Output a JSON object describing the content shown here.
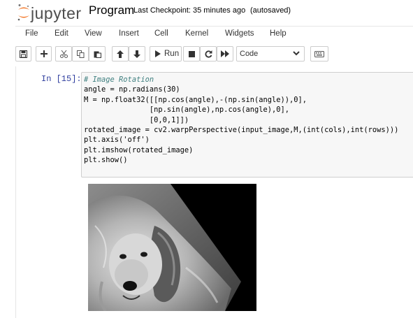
{
  "header": {
    "logo_text": "jupyter",
    "notebook_title": "Program",
    "checkpoint": "Last Checkpoint: 35 minutes ago",
    "autosave": "(autosaved)"
  },
  "menu": [
    "File",
    "Edit",
    "View",
    "Insert",
    "Cell",
    "Kernel",
    "Widgets",
    "Help"
  ],
  "toolbar": {
    "run_label": "Run",
    "cell_type": "Code",
    "icons": [
      "save-icon",
      "plus-icon",
      "cut-icon",
      "copy-icon",
      "paste-icon",
      "arrow-up-icon",
      "arrow-down-icon",
      "run-icon",
      "stop-icon",
      "restart-icon",
      "fast-forward-icon",
      "keyboard-icon"
    ]
  },
  "cell": {
    "prompt": "In [15]:",
    "lines": [
      "# Image Rotation",
      "angle = np.radians(30)",
      "M = np.float32([[np.cos(angle),-(np.sin(angle)),0],",
      "               [np.sin(angle),np.cos(angle),0],",
      "               [0,0,1]])",
      "rotated_image = cv2.warpPerspective(input_image,M,(int(cols),int(rows)))",
      "plt.axis('off')",
      "plt.imshow(rotated_image)",
      "plt.show()"
    ]
  },
  "colors": {
    "prompt": "#303f9f",
    "logo_orange": "#f37626",
    "cell_bg": "#f7f7f7"
  }
}
